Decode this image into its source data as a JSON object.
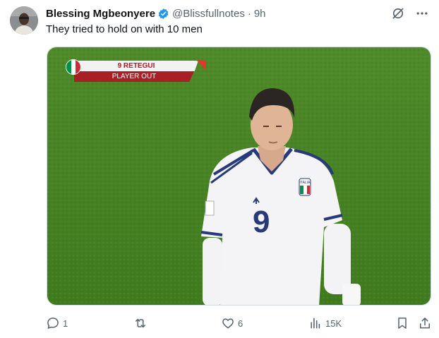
{
  "tweet": {
    "author_name": "Blessing Mgbeonyere",
    "handle": "@Blissfullnotes",
    "separator": "·",
    "time": "9h",
    "text": "They tried to hold on with 10 men",
    "verified": true,
    "verified_color": "#1d9bf0"
  },
  "header_icons": [
    "grok-icon",
    "more-icon"
  ],
  "media": {
    "overlay": {
      "player_line": "9 RETEGUI",
      "status": "PLAYER OUT",
      "accent_color": "#a91f26",
      "flag_colors": [
        "#009246",
        "#ffffff",
        "#ce2b37"
      ]
    },
    "jersey_number": "9",
    "crest_text": "ITALIA",
    "pitch_color": "#4f8a2a"
  },
  "actions": {
    "replies": "1",
    "reposts": "",
    "likes": "6",
    "views": "15K"
  },
  "action_icons": [
    "reply-icon",
    "repost-icon",
    "like-icon",
    "views-icon",
    "bookmark-icon",
    "share-icon"
  ]
}
